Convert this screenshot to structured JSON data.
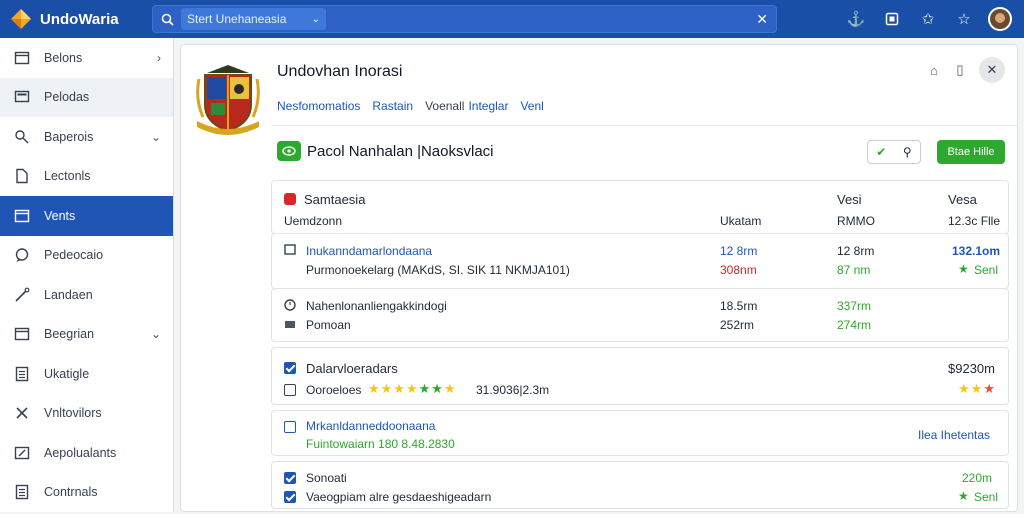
{
  "app": {
    "title": "UndoWaria"
  },
  "search": {
    "chip_text": "Stert Unehaneasia"
  },
  "sidebar": {
    "items": [
      {
        "label": "Belons",
        "icon": "window-icon",
        "chevron": "›"
      },
      {
        "label": "Pelodas",
        "icon": "monitor-icon",
        "chevron": ""
      },
      {
        "label": "Baperois",
        "icon": "search-person-icon",
        "chevron": "⌄"
      },
      {
        "label": "Lectonls",
        "icon": "document-icon",
        "chevron": ""
      },
      {
        "label": "Vents",
        "icon": "window-icon",
        "chevron": ""
      },
      {
        "label": "Pedeocaio",
        "icon": "chat-icon",
        "chevron": ""
      },
      {
        "label": "Landaen",
        "icon": "pen-icon",
        "chevron": ""
      },
      {
        "label": "Beegrian",
        "icon": "window-icon",
        "chevron": "⌄"
      },
      {
        "label": "Ukatigle",
        "icon": "list-icon",
        "chevron": ""
      },
      {
        "label": "Vnltovilors",
        "icon": "tools-icon",
        "chevron": ""
      },
      {
        "label": "Aepolualants",
        "icon": "edit-icon",
        "chevron": ""
      },
      {
        "label": "Contrnals",
        "icon": "list-icon",
        "chevron": ""
      }
    ]
  },
  "main": {
    "title": "Undovhan Inorasi",
    "tabs": [
      "Nesfomomatios",
      "Rastain",
      "Voenall",
      "Integlar",
      "Venl"
    ],
    "toolbar_text": "Pacol Nanhalan |Naoksvlaci",
    "primary_button": "Btae Hille"
  },
  "table": {
    "header": {
      "title": "Samtaesia",
      "subtitle": "Uemdzonn",
      "col1": "Ukatam",
      "col2_title": "Vesi",
      "col2": "RMMO",
      "col3_title": "Vesa",
      "col3": "12.3c Flle"
    },
    "row1": {
      "line1": "Inukanndamarlondaana",
      "line2": "Purmonoekelarg (MAKdS, SI. SIK 11 NKMJA101)",
      "c1a": "12 8rm",
      "c1b": "308nm",
      "c2a": "12 8rm",
      "c2b": "87 nm",
      "c3a": "132.1om",
      "c3b": "Senl"
    },
    "row2": {
      "line1": "Nahenlonanliengakkindogi",
      "line2": "Pomoan",
      "c1a": "18.5rm",
      "c1b": "252rm",
      "c2a": "337rm",
      "c2b": "274rm"
    },
    "row3": {
      "line1": "Dalarvloeradars",
      "line2": "Ooroeloes",
      "rating_text": "31.9036|2.3m",
      "amount": "$9230m"
    },
    "row4": {
      "line1": "Mrkanldanneddoonaana",
      "line2": "Fuintowaiarn 180 8.48.2830",
      "link": "Ilea Ihetentas"
    },
    "row5": {
      "line1": "Sonoati",
      "line2": "Vaeogpiam alre gesdaeshigeadarn",
      "c3a": "220m",
      "c3b": "Senl"
    }
  },
  "colors": {
    "brand": "#1a4fa8",
    "accent": "#2ea82e",
    "link": "#1f56b6"
  }
}
